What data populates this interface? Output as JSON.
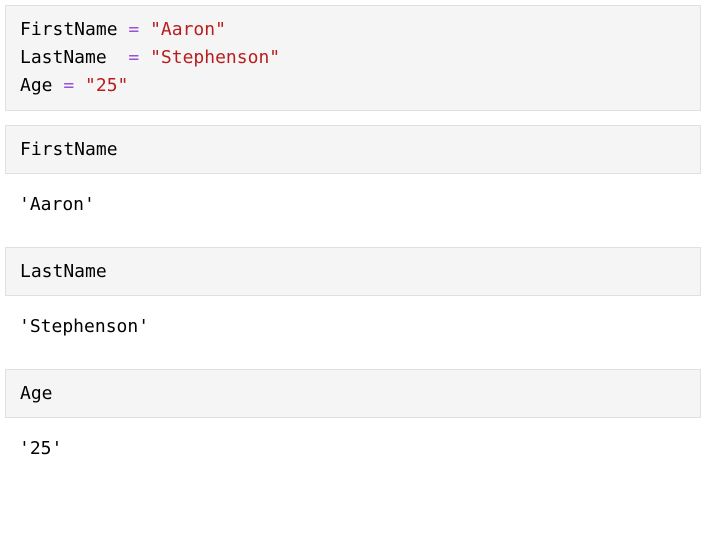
{
  "main_block": {
    "line1": {
      "var": "FirstName",
      "pad": " ",
      "op": "=",
      "str": "\"Aaron\""
    },
    "line2": {
      "var": "LastName",
      "pad": "  ",
      "op": "=",
      "str": "\"Stephenson\""
    },
    "line3": {
      "var": "Age",
      "pad": " ",
      "op": "=",
      "str": "\"25\""
    }
  },
  "cells": [
    {
      "input": "FirstName",
      "output": "'Aaron'"
    },
    {
      "input": "LastName",
      "output": "'Stephenson'"
    },
    {
      "input": "Age",
      "output": "'25'"
    }
  ]
}
